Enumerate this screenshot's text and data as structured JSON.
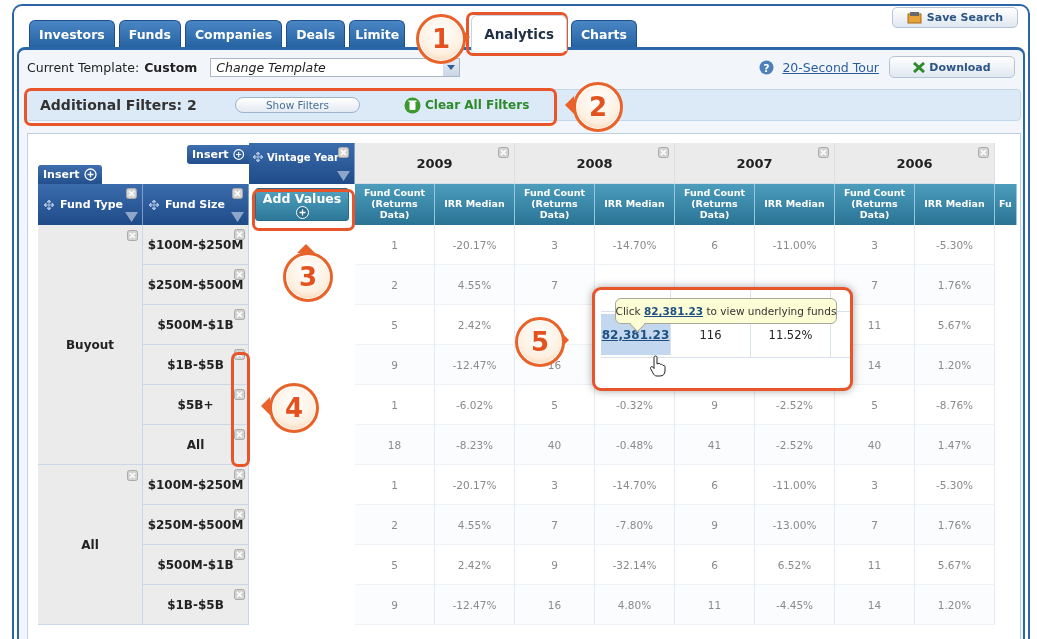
{
  "tabs": [
    {
      "label": "Investors",
      "selected": false
    },
    {
      "label": "Funds",
      "selected": false
    },
    {
      "label": "Companies",
      "selected": false
    },
    {
      "label": "Deals",
      "selected": false
    },
    {
      "label": "Limite",
      "selected": false
    },
    {
      "label": "Analytics",
      "selected": true
    },
    {
      "label": "Charts",
      "selected": false
    }
  ],
  "save_search": "Save Search",
  "template": {
    "label": "Current Template:",
    "value": "Custom",
    "dropdown": "Change Template"
  },
  "help_icon": "?",
  "tour_link": "20-Second Tour",
  "download": "Download",
  "filters": {
    "label": "Additional Filters: 2",
    "show_button": "Show Filters",
    "clear_button": "Clear All Filters"
  },
  "pivot": {
    "insert_column": "Insert",
    "insert_row": "Insert",
    "column_field": "Vintage Year",
    "row_fields": [
      "Fund Type",
      "Fund Size"
    ],
    "add_values": "Add Values",
    "years": [
      {
        "year": "2009",
        "measures": [
          "Fund Count (Returns Data)",
          "IRR Median"
        ]
      },
      {
        "year": "2008",
        "measures": [
          "Fund Count (Returns Data)",
          "IRR Median"
        ]
      },
      {
        "year": "2007",
        "measures": [
          "Fund Count (Returns Data)",
          "IRR Median"
        ]
      },
      {
        "year": "2006",
        "measures": [
          "Fund Count (Returns Data)",
          "IRR Median"
        ]
      }
    ],
    "cut_column": "Fu",
    "groups": [
      {
        "label": "Buyout",
        "rows": [
          {
            "size": "$100M-$250M",
            "cells": [
              "1",
              "-20.17%",
              "3",
              "-14.70%",
              "6",
              "-11.00%",
              "3",
              "-5.30%"
            ]
          },
          {
            "size": "$250M-$500M",
            "cells": [
              "2",
              "4.55%",
              "7",
              null,
              null,
              null,
              "7",
              "1.76%"
            ]
          },
          {
            "size": "$500M-$1B",
            "cells": [
              "5",
              "2.42%",
              null,
              null,
              null,
              null,
              "11",
              "5.67%"
            ]
          },
          {
            "size": "$1B-$5B",
            "cells": [
              "9",
              "-12.47%",
              "16",
              null,
              null,
              null,
              "14",
              "1.20%"
            ]
          },
          {
            "size": "$5B+",
            "cells": [
              "1",
              "-6.02%",
              "5",
              "-0.32%",
              "9",
              "-2.52%",
              "5",
              "-8.76%"
            ]
          },
          {
            "size": "All",
            "cells": [
              "18",
              "-8.23%",
              "40",
              "-0.48%",
              "41",
              "-2.52%",
              "40",
              "1.47%"
            ]
          }
        ]
      },
      {
        "label": "All",
        "rows": [
          {
            "size": "$100M-$250M",
            "cells": [
              "1",
              "-20.17%",
              "3",
              "-14.70%",
              "6",
              "-11.00%",
              "3",
              "-5.30%"
            ]
          },
          {
            "size": "$250M-$500M",
            "cells": [
              "2",
              "4.55%",
              "7",
              "-7.80%",
              "9",
              "-13.00%",
              "7",
              "1.76%"
            ]
          },
          {
            "size": "$500M-$1B",
            "cells": [
              "5",
              "2.42%",
              "9",
              "-32.14%",
              "6",
              "6.52%",
              "11",
              "5.67%"
            ]
          },
          {
            "size": "$1B-$5B",
            "cells": [
              "9",
              "-12.47%",
              "16",
              "4.80%",
              "11",
              "-4.45%",
              "14",
              "1.20%"
            ]
          }
        ]
      }
    ]
  },
  "callout": {
    "tooltip_before": "Click ",
    "tooltip_link": "82,381.23",
    "tooltip_after": " to view underlying funds",
    "row": [
      "82,381.23",
      "116",
      "11.52%"
    ]
  },
  "badges": [
    "1",
    "2",
    "3",
    "4",
    "5"
  ]
}
